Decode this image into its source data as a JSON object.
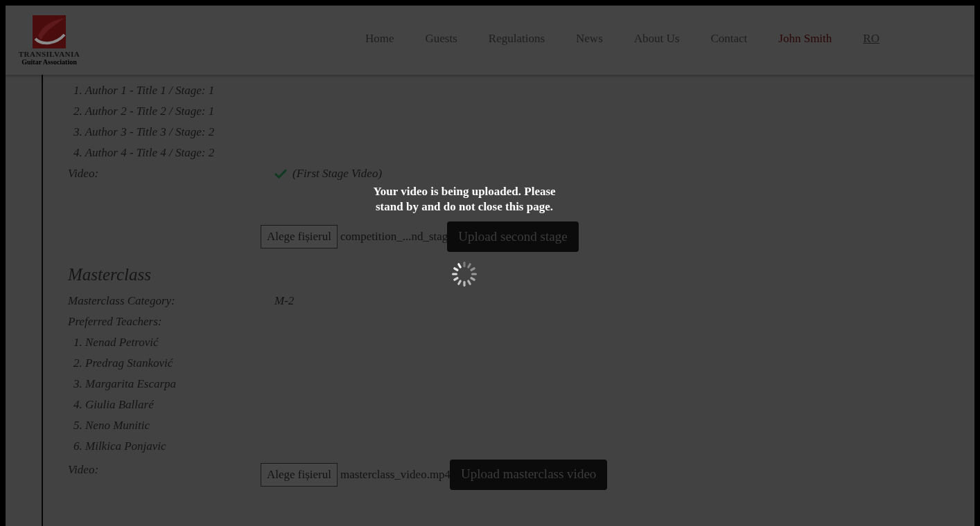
{
  "header": {
    "logo": {
      "name": "TRANSILVANIA",
      "tagline": "Guitar Association"
    },
    "nav": [
      {
        "label": "Home",
        "kind": "link"
      },
      {
        "label": "Guests",
        "kind": "link"
      },
      {
        "label": "Regulations",
        "kind": "link"
      },
      {
        "label": "News",
        "kind": "link"
      },
      {
        "label": "About Us",
        "kind": "link"
      },
      {
        "label": "Contact",
        "kind": "link"
      },
      {
        "label": "John Smith",
        "kind": "user"
      },
      {
        "label": "RO",
        "kind": "language"
      }
    ]
  },
  "competition": {
    "pieces": [
      "1. Author 1 - Title 1 / Stage: 1",
      "2. Author 2 - Title 2 / Stage: 1",
      "3. Author 3 - Title 3 / Stage: 2",
      "4. Author 4 - Title 4 / Stage: 2"
    ],
    "video_label": "Video:",
    "video_uploaded": true,
    "video_status": "(First Stage Video)",
    "file_button": "Alege fișierul",
    "file_name": "competition_...nd_stag",
    "upload_button": "Upload second stage"
  },
  "masterclass": {
    "title": "Masterclass",
    "category_label": "Masterclass Category:",
    "category_value": "M-2",
    "teachers_label": "Preferred Teachers:",
    "teachers": [
      "1. Nenad Petrović",
      "2. Predrag Stanković",
      "3. Margarita Escarpa",
      "4. Giulia Ballaré",
      "5. Neno Munitic",
      "6. Milkica Ponjavic"
    ],
    "video_label": "Video:",
    "file_button": "Alege fișierul",
    "file_name": "masterclass_video.mp4",
    "upload_button": "Upload masterclass video"
  },
  "overlay": {
    "message": "Your video is being uploaded. Please stand by and do not close this page."
  }
}
